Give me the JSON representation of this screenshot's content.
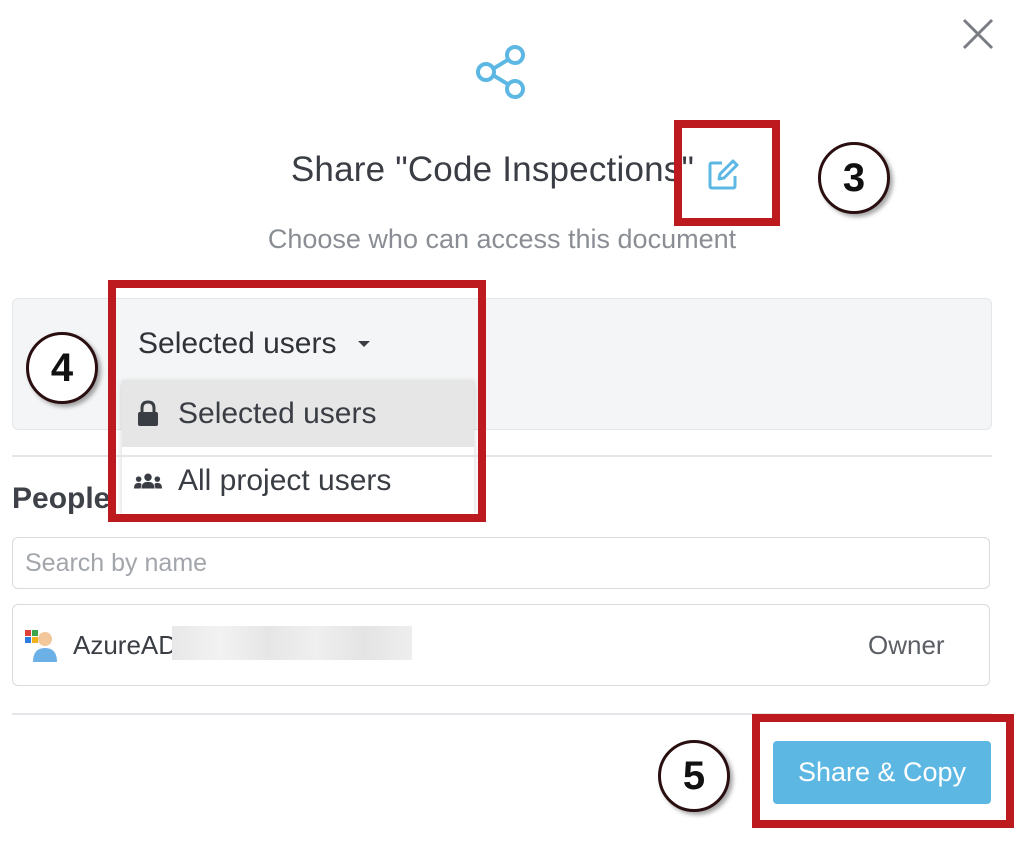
{
  "dialog": {
    "title": "Share \"Code Inspections\"",
    "subtitle": "Choose who can access this document",
    "access": {
      "selected_value": "Selected users",
      "options": [
        {
          "label": "Selected users",
          "icon": "lock-icon",
          "selected": true
        },
        {
          "label": "All project users",
          "icon": "group-icon",
          "selected": false
        }
      ]
    },
    "people": {
      "label": "People",
      "search_placeholder": "Search by name",
      "users": [
        {
          "name": "AzureAD\\",
          "role": "Owner",
          "avatar": "user-avatar-icon"
        }
      ]
    },
    "share_button_label": "Share & Copy"
  },
  "annotations": [
    {
      "number": "3"
    },
    {
      "number": "4"
    },
    {
      "number": "5"
    }
  ],
  "colors": {
    "accent": "#5cb8e3",
    "annotation_red": "#bd1a1f",
    "title_text": "#3a3e44",
    "subtitle_text": "#8a8e94"
  }
}
